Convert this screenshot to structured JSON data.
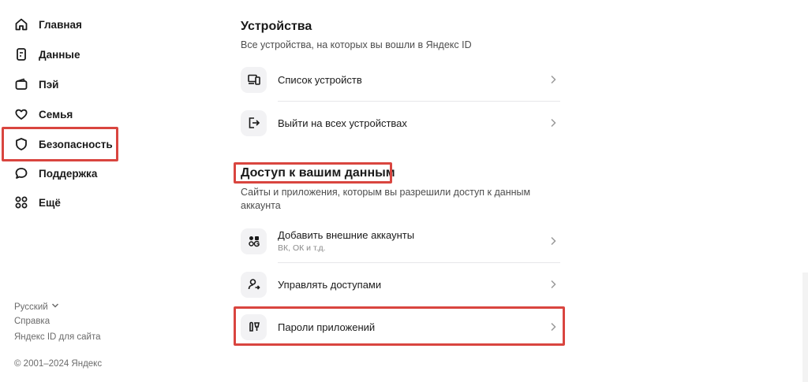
{
  "sidebar": {
    "items": [
      {
        "label": "Главная",
        "icon": "home-icon"
      },
      {
        "label": "Данные",
        "icon": "id-card-icon"
      },
      {
        "label": "Пэй",
        "icon": "wallet-icon"
      },
      {
        "label": "Семья",
        "icon": "heart-icon"
      },
      {
        "label": "Безопасность",
        "icon": "shield-icon",
        "active": true
      },
      {
        "label": "Поддержка",
        "icon": "chat-icon"
      },
      {
        "label": "Ещё",
        "icon": "grid-icon"
      }
    ],
    "footer": {
      "language": "Русский",
      "help": "Справка",
      "id_for_site": "Яндекс ID для сайта",
      "copyright": "© 2001–2024 Яндекс"
    }
  },
  "devices": {
    "title": "Устройства",
    "description": "Все устройства, на которых вы вошли в Яндекс ID",
    "rows": [
      {
        "label": "Список устройств",
        "icon": "devices-icon"
      },
      {
        "label": "Выйти на всех устройствах",
        "icon": "logout-icon"
      }
    ]
  },
  "access": {
    "title": "Доступ к вашим данным",
    "description": "Сайты и приложения, которым вы разрешили доступ к данным аккаунта",
    "rows": [
      {
        "label": "Добавить внешние аккаунты",
        "sublabel": "ВК, ОК и т.д.",
        "icon": "external-accounts-icon"
      },
      {
        "label": "Управлять доступами",
        "icon": "manage-access-icon"
      },
      {
        "label": "Пароли приложений",
        "icon": "app-passwords-icon"
      }
    ]
  },
  "colors": {
    "highlight": "#d9453f",
    "icon_bg": "#f2f2f4"
  }
}
